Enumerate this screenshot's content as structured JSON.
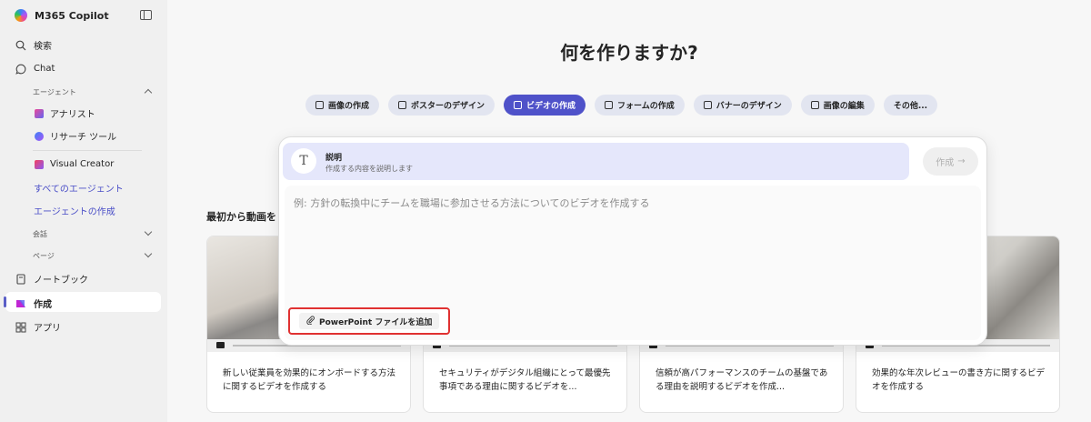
{
  "app": {
    "title": "M365 Copilot"
  },
  "sidebar": {
    "search_label": "検索",
    "chat_label": "Chat",
    "agents_header": "エージェント",
    "agents": [
      {
        "label": "アナリスト",
        "icon": "analyst-icon"
      },
      {
        "label": "リサーチ ツール",
        "icon": "researcher-icon"
      },
      {
        "label": "Visual Creator",
        "icon": "visual-creator-icon"
      }
    ],
    "all_agents_link": "すべてのエージェント",
    "create_agent_link": "エージェントの作成",
    "conversations_header": "会話",
    "pages_header": "ページ",
    "notebook_label": "ノートブック",
    "create_label": "作成",
    "apps_label": "アプリ",
    "accent_color": "#5b5fc7"
  },
  "main": {
    "heading": "何を作りますか?",
    "chips": [
      {
        "label": "画像の作成",
        "icon": "image-icon",
        "active": false
      },
      {
        "label": "ポスターのデザイン",
        "icon": "poster-icon",
        "active": false
      },
      {
        "label": "ビデオの作成",
        "icon": "video-icon",
        "active": true
      },
      {
        "label": "フォームの作成",
        "icon": "form-icon",
        "active": false
      },
      {
        "label": "バナーのデザイン",
        "icon": "banner-icon",
        "active": false
      },
      {
        "label": "画像の編集",
        "icon": "edit-image-icon",
        "active": false
      },
      {
        "label": "その他...",
        "icon": "",
        "active": false
      }
    ],
    "section_title": "最初から動画を",
    "cards": [
      {
        "text": "新しい従業員を効果的にオンボードする方法に関するビデオを作成する"
      },
      {
        "text": "セキュリティがデジタル組織にとって最優先事項である理由に関するビデオを..."
      },
      {
        "text": "信頼が高パフォーマンスのチームの基盤である理由を説明するビデオを作成..."
      },
      {
        "text": "効果的な年次レビューの書き方に関するビデオを作成する"
      }
    ]
  },
  "dialog": {
    "desc_icon": "T",
    "desc_title": "説明",
    "desc_subtitle": "作成する内容を説明します",
    "create_button": "作成",
    "prompt_placeholder": "例: 方針の転換中にチームを職場に参加させる方法についてのビデオを作成する",
    "attach_button": "PowerPoint ファイルを追加"
  }
}
